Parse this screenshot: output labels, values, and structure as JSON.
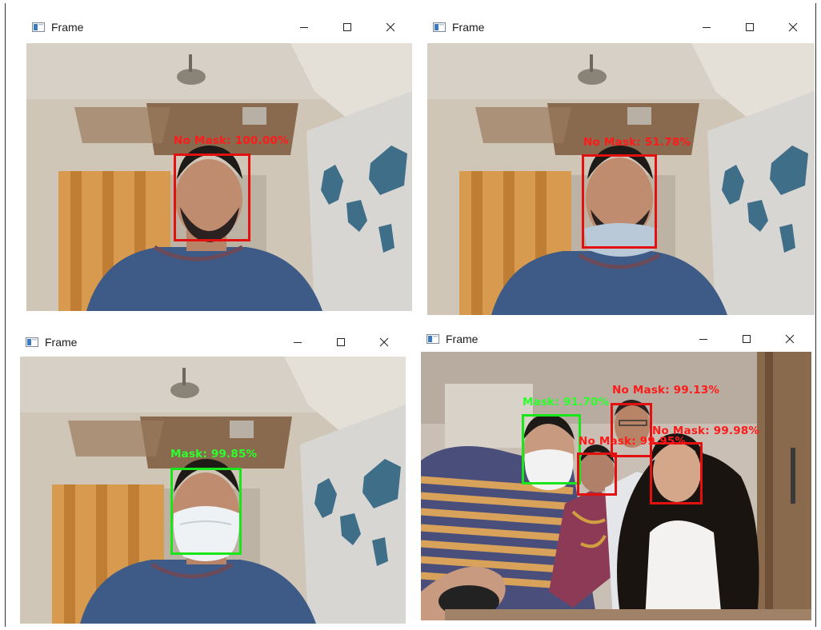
{
  "windows": [
    {
      "title": "Frame",
      "detections": [
        {
          "label": "No Mask: 100.00%",
          "status": "no-mask"
        }
      ]
    },
    {
      "title": "Frame",
      "detections": [
        {
          "label": "No Mask: 51.78%",
          "status": "no-mask"
        }
      ]
    },
    {
      "title": "Frame",
      "detections": [
        {
          "label": "Mask: 99.85%",
          "status": "mask"
        }
      ]
    },
    {
      "title": "Frame",
      "detections": [
        {
          "label": "Mask: 91.70%",
          "status": "mask"
        },
        {
          "label": "No Mask: 99.13%",
          "status": "no-mask"
        },
        {
          "label": "No Mask: 99.98%",
          "status": "no-mask"
        },
        {
          "label": "No Mask: 99.95%",
          "status": "no-mask"
        }
      ]
    }
  ],
  "colors": {
    "mask": "#19e619",
    "no_mask": "#e31010"
  },
  "icons": {
    "window_icon": "app-window-icon",
    "minimize": "minimize-icon",
    "maximize": "maximize-icon",
    "close": "close-icon"
  }
}
